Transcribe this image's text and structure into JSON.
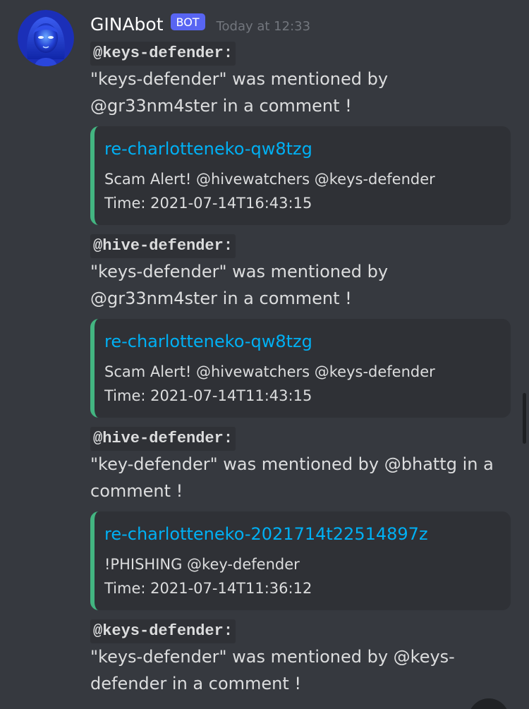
{
  "message": {
    "author": "GINAbot",
    "badge": "BOT",
    "timestamp": "Today at 12:33",
    "avatar_icon": "robot-woman-avatar-icon"
  },
  "blocks": [
    {
      "mention": "@keys-defender:",
      "text": "\"keys-defender\" was mentioned by @gr33nm4ster in a comment !",
      "embed": {
        "title": "re-charlotteneko-qw8tzg",
        "line1": "Scam Alert! @hivewatchers @keys-defender",
        "line2": "Time: 2021-07-14T16:43:15"
      }
    },
    {
      "mention": "@hive-defender:",
      "text": "\"keys-defender\" was mentioned by @gr33nm4ster in a comment !",
      "embed": {
        "title": "re-charlotteneko-qw8tzg",
        "line1": "Scam Alert! @hivewatchers @keys-defender",
        "line2": "Time: 2021-07-14T11:43:15"
      }
    },
    {
      "mention": "@hive-defender:",
      "text": "\"key-defender\" was mentioned by @bhattg in a comment !",
      "embed": {
        "title": "re-charlotteneko-2021714t22514897z",
        "line1": "!PHISHING @key-defender",
        "line2": "Time: 2021-07-14T11:36:12"
      }
    },
    {
      "mention": "@keys-defender:",
      "text": "\"keys-defender\" was mentioned by @keys-defender in a comment !"
    }
  ],
  "colors": {
    "background": "#36393f",
    "embed_background": "#2f3136",
    "embed_border": "#43b581",
    "link": "#00b0f4",
    "badge": "#5865f2"
  }
}
